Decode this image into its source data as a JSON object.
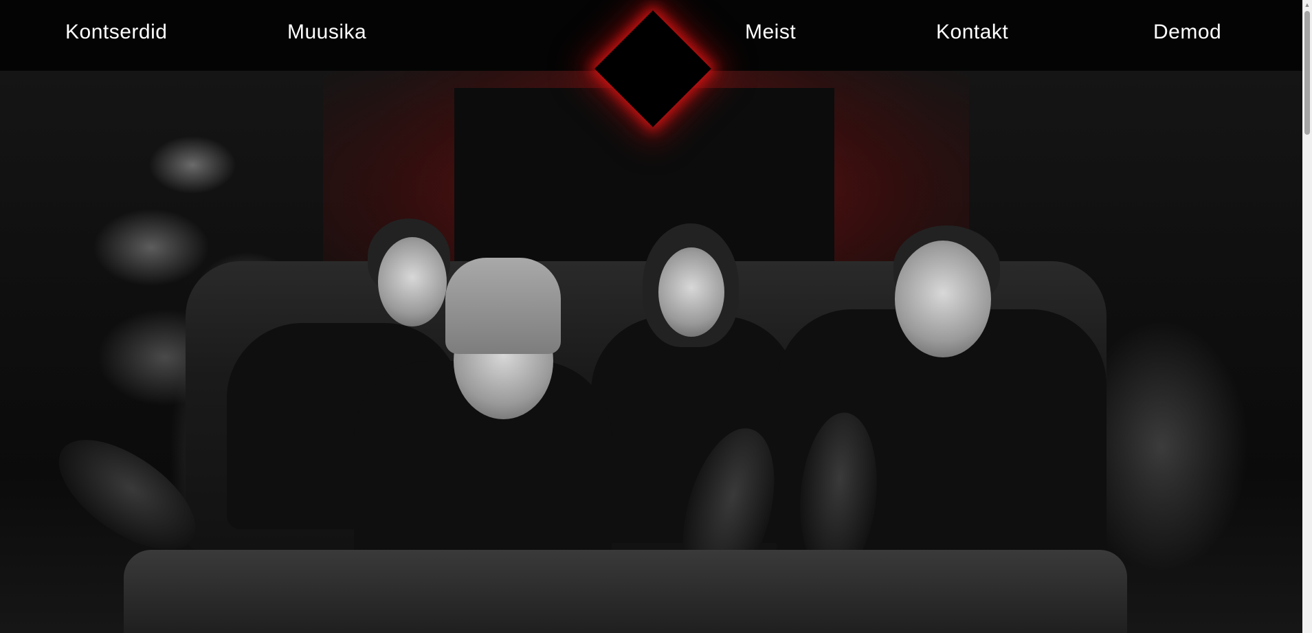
{
  "nav": {
    "items": [
      {
        "label": "Kontserdid"
      },
      {
        "label": "Muusika"
      },
      {
        "label": "Meist"
      },
      {
        "label": "Kontakt"
      },
      {
        "label": "Demod"
      }
    ],
    "logo": {
      "shape": "black-diamond",
      "glow_color": "#d11a1a"
    }
  },
  "hero": {
    "image": "band-photo-black-and-white-with-red-background"
  },
  "scrollbar": {
    "arrow_icon": "triangle-up"
  },
  "colors": {
    "navbar_background": "#040404",
    "nav_text": "#ffffff",
    "accent_red": "#d11a1a"
  }
}
